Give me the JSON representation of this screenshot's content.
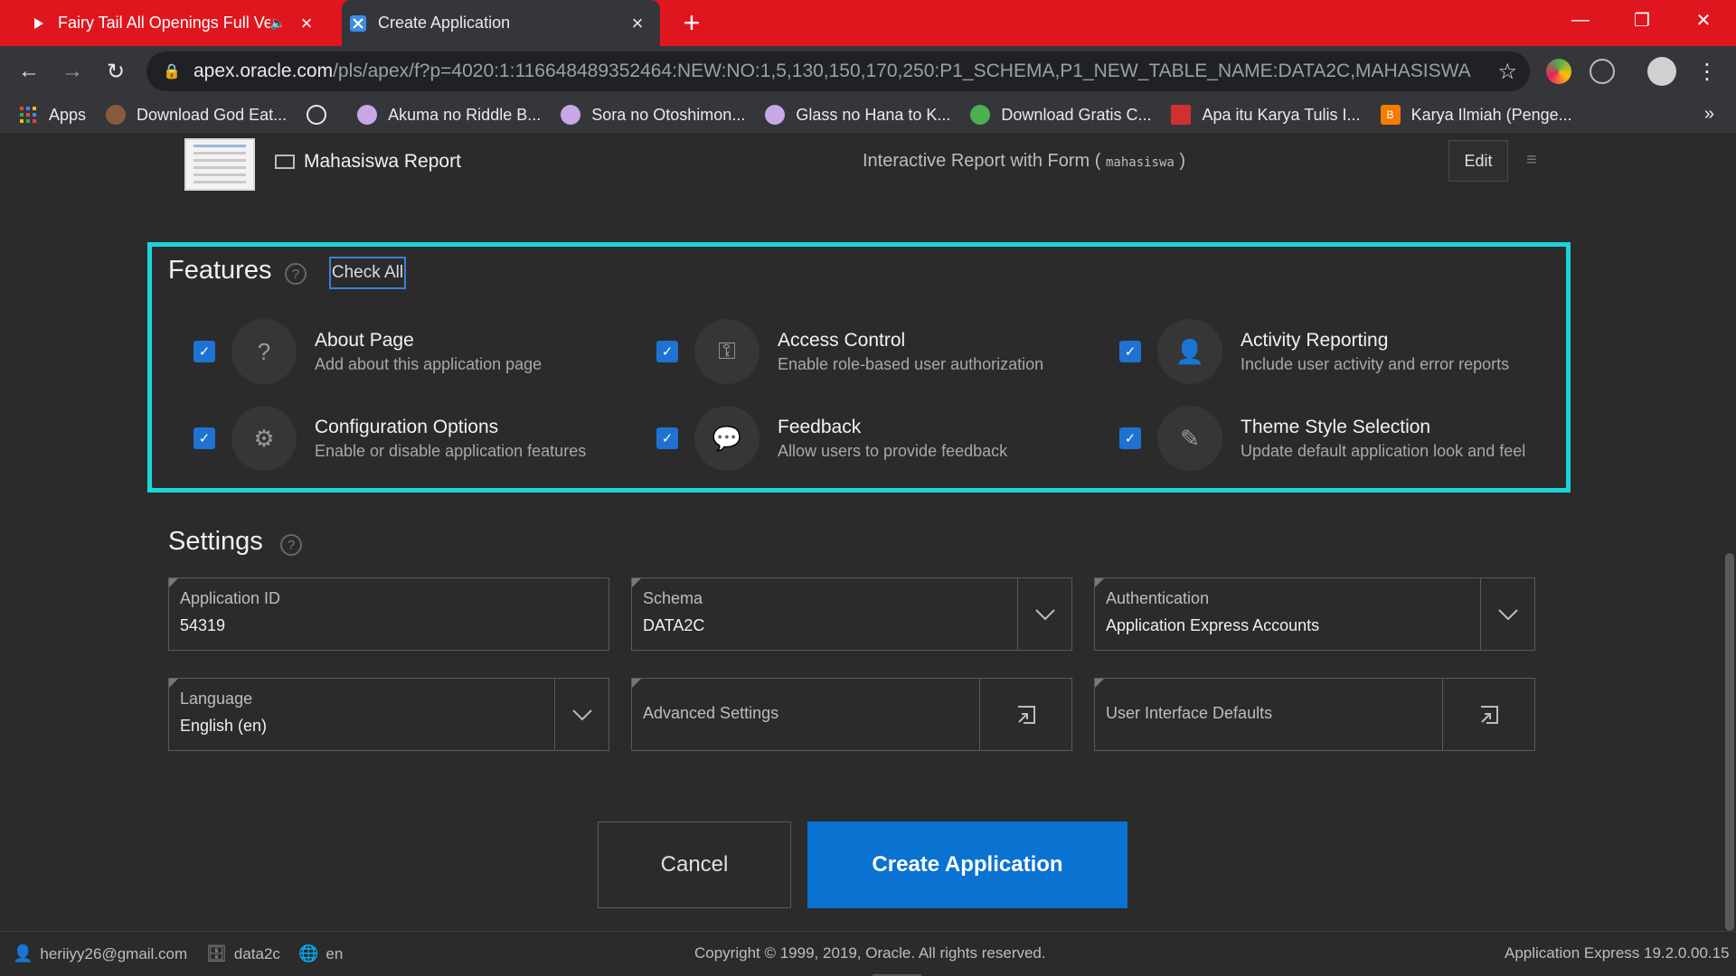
{
  "browser": {
    "tabs": [
      {
        "title": "Fairy Tail All Openings Full Ve",
        "state": "inactive",
        "icon": "youtube-icon",
        "audio": "speaker-icon"
      },
      {
        "title": "Create Application",
        "state": "active",
        "icon": "apex-icon"
      }
    ],
    "address": {
      "host": "apex.oracle.com",
      "path": "/pls/apex/f?p=4020:1:116648489352464:NEW:NO:1,5,130,150,170,250:P1_SCHEMA,P1_NEW_TABLE_NAME:DATA2C,MAHASISWA"
    },
    "bookmarks": [
      {
        "label": "Apps",
        "icon": "apps-grid-icon",
        "color": "#4285f4"
      },
      {
        "label": "Download God Eat...",
        "icon": "anime-icon",
        "color": "#8a5a3c"
      },
      {
        "label": "",
        "icon": "globe-icon",
        "color": "#e8eaed"
      },
      {
        "label": "Akuma no Riddle B...",
        "icon": "paw-icon",
        "color": "#c7a7e6"
      },
      {
        "label": "Sora no Otoshimon...",
        "icon": "paw-icon",
        "color": "#c7a7e6"
      },
      {
        "label": "Glass no Hana to K...",
        "icon": "paw-icon",
        "color": "#c7a7e6"
      },
      {
        "label": "Download Gratis C...",
        "icon": "leaf-icon",
        "color": "#4caf50"
      },
      {
        "label": "Apa itu Karya Tulis I...",
        "icon": "flag-icon",
        "color": "#d32f2f"
      },
      {
        "label": "Karya Ilmiah (Penge...",
        "icon": "blogger-icon",
        "color": "#f57c00"
      }
    ],
    "more": "»"
  },
  "report": {
    "name": "Mahasiswa Report",
    "type_label": "Interactive Report with Form (",
    "type_table": "mahasiswa",
    "type_close": ")",
    "edit_label": "Edit"
  },
  "features": {
    "title": "Features",
    "check_all": "Check All",
    "items": [
      {
        "title": "About Page",
        "desc": "Add about this application page",
        "icon": "question-icon",
        "checked": true
      },
      {
        "title": "Access Control",
        "desc": "Enable role-based user authorization",
        "icon": "key-icon",
        "checked": true
      },
      {
        "title": "Activity Reporting",
        "desc": "Include user activity and error reports",
        "icon": "user-chart-icon",
        "checked": true
      },
      {
        "title": "Configuration Options",
        "desc": "Enable or disable application features",
        "icon": "sliders-icon",
        "checked": true
      },
      {
        "title": "Feedback",
        "desc": "Allow users to provide feedback",
        "icon": "speech-bubble-icon",
        "checked": true
      },
      {
        "title": "Theme Style Selection",
        "desc": "Update default application look and feel",
        "icon": "brush-icon",
        "checked": true
      }
    ]
  },
  "settings": {
    "title": "Settings",
    "app_id": {
      "label": "Application ID",
      "value": "54319"
    },
    "schema": {
      "label": "Schema",
      "value": "DATA2C"
    },
    "authentication": {
      "label": "Authentication",
      "value": "Application Express Accounts"
    },
    "language": {
      "label": "Language",
      "value": "English (en)"
    },
    "advanced": {
      "label": "Advanced Settings"
    },
    "ui_defaults": {
      "label": "User Interface Defaults"
    }
  },
  "actions": {
    "cancel": "Cancel",
    "create": "Create Application"
  },
  "footer": {
    "user": "heriiyy26@gmail.com",
    "workspace": "data2c",
    "language": "en",
    "copyright": "Copyright © 1999, 2019, Oracle. All rights reserved.",
    "version": "Application Express 19.2.0.00.15"
  },
  "colors": {
    "highlight": "#1ad6dc",
    "primary": "#0a72d1",
    "chrome_red": "#e0161f"
  }
}
